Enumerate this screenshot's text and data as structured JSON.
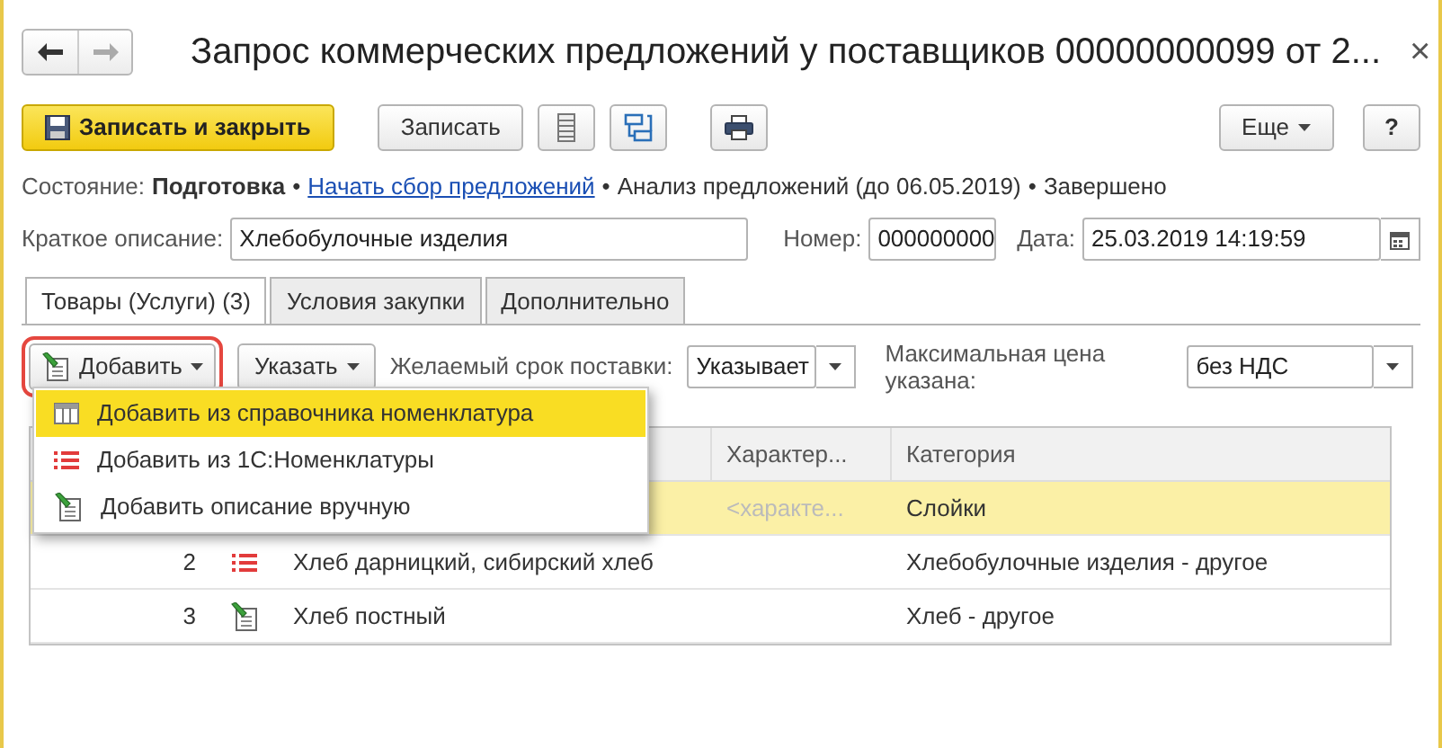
{
  "window": {
    "title": "Запрос коммерческих предложений у поставщиков 00000000099 от 2...",
    "close": "×"
  },
  "toolbar": {
    "save_close": "Записать и закрыть",
    "save": "Записать",
    "more": "Еще",
    "help": "?"
  },
  "status": {
    "label": "Состояние:",
    "separator": "•",
    "steps": [
      {
        "kind": "current",
        "text": "Подготовка"
      },
      {
        "kind": "link",
        "text": "Начать сбор предложений"
      },
      {
        "kind": "plain",
        "text": "Анализ предложений (до 06.05.2019)"
      },
      {
        "kind": "plain",
        "text": "Завершено"
      }
    ]
  },
  "fields": {
    "description_label": "Краткое описание:",
    "description": "Хлебобулочные изделия",
    "number_label": "Номер:",
    "number": "000000000",
    "date_label": "Дата:",
    "date": "25.03.2019 14:19:59"
  },
  "tabs": [
    {
      "label": "Товары (Услуги) (3)",
      "selected": true
    },
    {
      "label": "Условия закупки",
      "selected": false
    },
    {
      "label": "Дополнительно",
      "selected": false
    }
  ],
  "table_toolbar": {
    "add": "Добавить",
    "add_open": true,
    "specify": "Указать",
    "delivery_label": "Желаемый срок поставки:",
    "delivery": "Указывает",
    "price_label": "Максимальная цена указана:",
    "price": "без НДС"
  },
  "add_menu": [
    {
      "kind": "table",
      "label": "Добавить из справочника номенклатура",
      "selected": true
    },
    {
      "kind": "list",
      "label": "Добавить из 1С:Номенклатуры",
      "selected": false
    },
    {
      "kind": "manual",
      "label": "Добавить описание вручную",
      "selected": false
    }
  ],
  "table": {
    "columns": [
      "Характер...",
      "Категория"
    ],
    "rows": [
      {
        "characteristic": "<характе...",
        "category": "Слойки",
        "selected": true
      },
      {
        "number": "2",
        "kind": "list",
        "name": "Хлеб дарницкий, сибирский хлеб",
        "category": "Хлебобулочные изделия - другое",
        "selected": false
      },
      {
        "number": "3",
        "kind": "manual",
        "name": "Хлеб постный",
        "category": "Хлеб - другое",
        "selected": false
      }
    ]
  }
}
